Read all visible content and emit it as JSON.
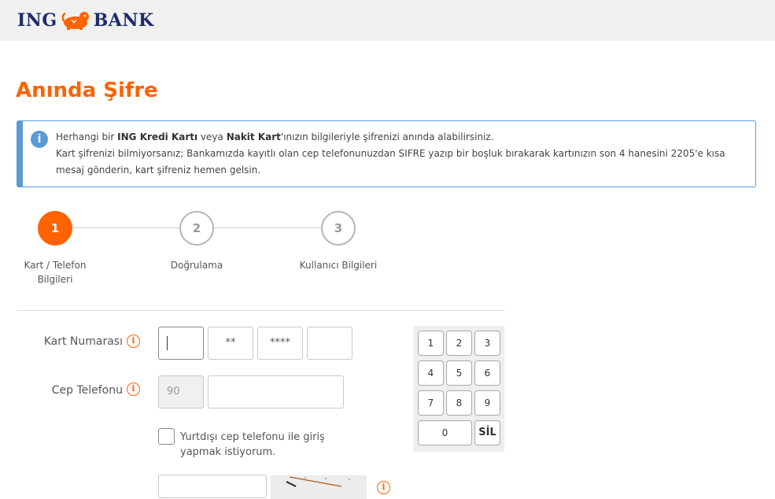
{
  "header": {
    "logo_left": "ING",
    "logo_right": "BANK"
  },
  "page_title": "Anında Şifre",
  "info": {
    "line1_pre": "Herhangi bir ",
    "line1_bold1": "ING Kredi Kartı",
    "line1_mid": " veya ",
    "line1_bold2": "Nakit Kart",
    "line1_post": "'ınızın bilgileriyle şifrenizi anında alabilirsiniz.",
    "line2": "Kart şifrenizi bilmiyorsanız; Bankamızda kayıtlı olan cep telefonunuzdan SIFRE yazıp bir boşluk bırakarak kartınızın son 4 hanesini 2205'e kısa mesaj gönderin, kart şifreniz hemen gelsin."
  },
  "steps": [
    {
      "number": "1",
      "label_line1": "Kart / Telefon",
      "label_line2": "Bilgileri"
    },
    {
      "number": "2",
      "label_line1": "Doğrulama",
      "label_line2": ""
    },
    {
      "number": "3",
      "label_line1": "Kullanıcı Bilgileri",
      "label_line2": ""
    }
  ],
  "form": {
    "card_label": "Kart Numarası",
    "card_fields": [
      "",
      "**",
      "****",
      ""
    ],
    "phone_label": "Cep Telefonu",
    "phone_prefix": "90",
    "phone_value": "",
    "abroad_label": "Yurtdışı cep telefonu ile giriş yapmak istiyorum."
  },
  "keypad": {
    "keys": [
      "1",
      "2",
      "3",
      "4",
      "5",
      "6",
      "7",
      "8",
      "9",
      "0",
      "SİL"
    ]
  },
  "help_glyph": "i",
  "info_glyph": "i",
  "colors": {
    "accent": "#ff6200",
    "info": "#5b9bd5",
    "brand": "#1e2c6b"
  },
  "icons": {
    "logo": "lion-icon",
    "info": "info-icon",
    "help": "help-icon"
  }
}
